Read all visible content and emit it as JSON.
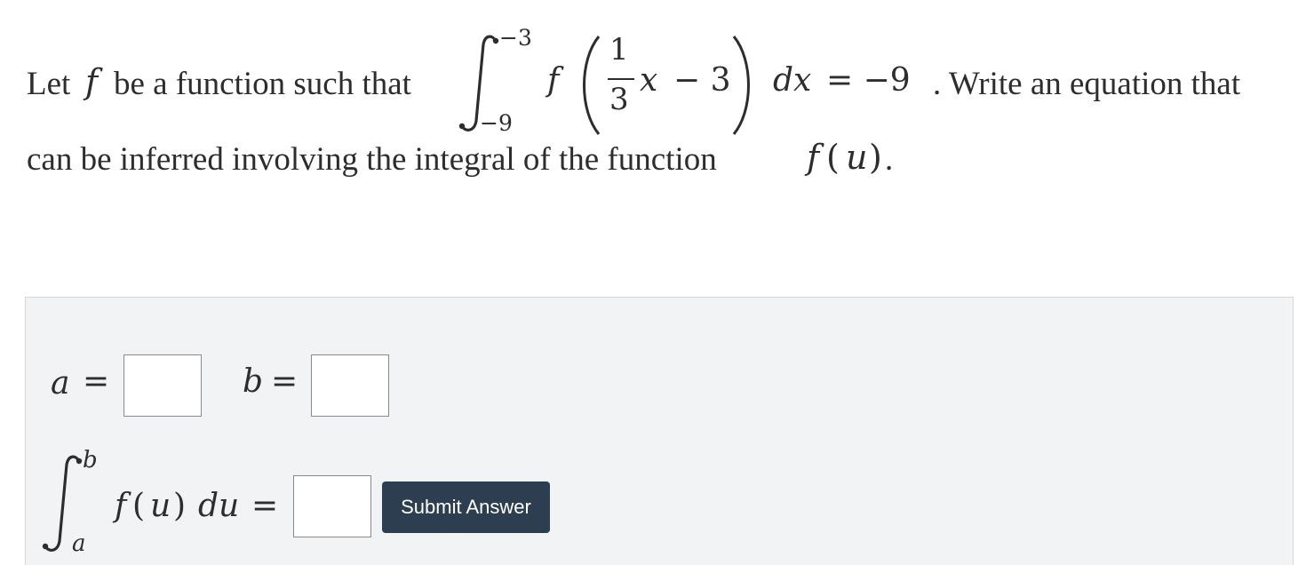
{
  "problem": {
    "text_before": "Let",
    "var_f": "f",
    "text_be": "be a function such that",
    "integral_upper": "−3",
    "integral_lower": "−9",
    "integrand_f": "f",
    "frac_num": "1",
    "frac_den": "3",
    "var_x": "x",
    "minus_three": "− 3",
    "dx": "dx",
    "equals_value": "= −9",
    "text_after": ". Write an equation that",
    "line2_text": "can be inferred involving the integral of the function",
    "line2_f": "f",
    "line2_u": "u",
    "line2_end": "."
  },
  "answer": {
    "label_a": "a",
    "label_b": "b",
    "equals": "=",
    "integral_upper": "b",
    "integral_lower": "a",
    "integrand": "f",
    "integrand_var": "u",
    "du": "du",
    "input_a_value": "",
    "input_b_value": "",
    "input_integral_value": "",
    "submit_label": "Submit Answer"
  },
  "colors": {
    "panel_background": "#f2f3f4",
    "button_background": "#2c3e50",
    "button_text": "#ffffff",
    "text": "#2d2d2d"
  }
}
